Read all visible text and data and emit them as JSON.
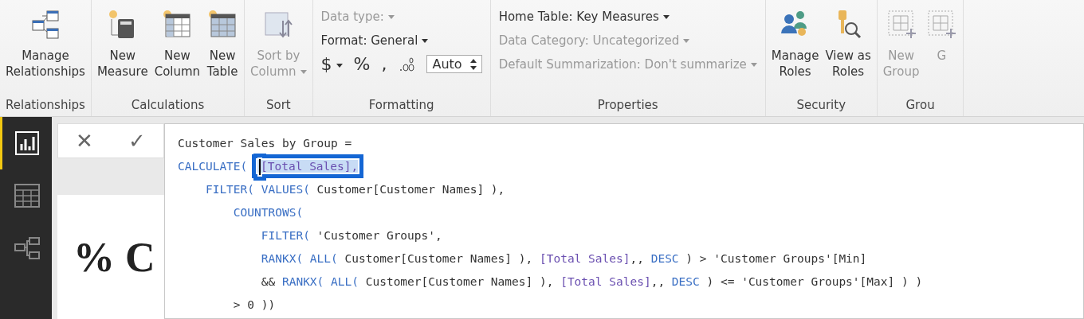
{
  "ribbon": {
    "groups": [
      {
        "label": "Relationships",
        "kind": "buttons",
        "buttons": [
          {
            "kind": "relationships",
            "label_lines": [
              "Manage",
              "Relationships"
            ],
            "disabled": false,
            "dropdown": false
          }
        ]
      },
      {
        "label": "Calculations",
        "kind": "buttons",
        "buttons": [
          {
            "kind": "measure",
            "label_lines": [
              "New",
              "Measure"
            ],
            "disabled": false,
            "dropdown": false
          },
          {
            "kind": "column",
            "label_lines": [
              "New",
              "Column"
            ],
            "disabled": false,
            "dropdown": false
          },
          {
            "kind": "table",
            "label_lines": [
              "New",
              "Table"
            ],
            "disabled": false,
            "dropdown": false
          }
        ]
      },
      {
        "label": "Sort",
        "kind": "buttons",
        "buttons": [
          {
            "kind": "sort",
            "label_lines": [
              "Sort by",
              "Column"
            ],
            "disabled": true,
            "dropdown": true
          }
        ]
      },
      {
        "label": "Formatting",
        "kind": "formatting",
        "rows": [
          {
            "label": "Data type:",
            "disabled": true
          },
          {
            "label": "Format: General",
            "disabled": false
          }
        ],
        "currency": "$",
        "percent": "%",
        "comma": ",",
        "decimals": "Auto"
      },
      {
        "label": "Properties",
        "kind": "properties",
        "rows": [
          {
            "label": "Home Table: Key Measures",
            "disabled": false
          },
          {
            "label": "Data Category: Uncategorized",
            "disabled": true
          },
          {
            "label": "Default Summarization: Don't summarize",
            "disabled": true
          }
        ]
      },
      {
        "label": "Security",
        "kind": "buttons",
        "buttons": [
          {
            "kind": "roles",
            "label_lines": [
              "Manage",
              "Roles"
            ],
            "disabled": false,
            "dropdown": false
          },
          {
            "kind": "view-roles",
            "label_lines": [
              "View as",
              "Roles"
            ],
            "disabled": false,
            "dropdown": false
          }
        ]
      },
      {
        "label": "Grou",
        "kind": "buttons",
        "buttons": [
          {
            "kind": "group",
            "label_lines": [
              "New",
              "Group"
            ],
            "disabled": true,
            "dropdown": false
          },
          {
            "kind": "group",
            "label_lines": [
              "G"
            ],
            "disabled": true,
            "dropdown": false
          }
        ]
      }
    ]
  },
  "sidebar": {
    "views": [
      {
        "kind": "report",
        "selected": true
      },
      {
        "kind": "data",
        "selected": false
      },
      {
        "kind": "model",
        "selected": false
      }
    ]
  },
  "formula_bar": {
    "cancel": "✕",
    "commit": "✓",
    "lines": [
      [
        {
          "text": "Customer Sales by Group =",
          "kind": "text",
          "selected": false
        }
      ],
      [
        {
          "text": "CALCULATE( ",
          "kind": "keyword",
          "selected": false
        },
        {
          "text": "[Total Sales],",
          "kind": "measure",
          "selected": true
        }
      ],
      [
        {
          "text": "    FILTER( VALUES(",
          "kind": "keyword",
          "selected": false
        },
        {
          "text": " Customer[Customer Names] ),",
          "kind": "text",
          "selected": false
        }
      ],
      [
        {
          "text": "        COUNTROWS(",
          "kind": "keyword",
          "selected": false
        }
      ],
      [
        {
          "text": "            FILTER(",
          "kind": "keyword",
          "selected": false
        },
        {
          "text": " 'Customer Groups',",
          "kind": "text",
          "selected": false
        }
      ],
      [
        {
          "text": "            RANKX( ALL(",
          "kind": "keyword",
          "selected": false
        },
        {
          "text": " Customer[Customer Names] ), ",
          "kind": "text",
          "selected": false
        },
        {
          "text": "[Total Sales]",
          "kind": "measure",
          "selected": false
        },
        {
          "text": ",, ",
          "kind": "text",
          "selected": false
        },
        {
          "text": "DESC",
          "kind": "keyword",
          "selected": false
        },
        {
          "text": " ) > 'Customer Groups'[Min]",
          "kind": "text",
          "selected": false
        }
      ],
      [
        {
          "text": "            && ",
          "kind": "text",
          "selected": false
        },
        {
          "text": "RANKX( ALL(",
          "kind": "keyword",
          "selected": false
        },
        {
          "text": " Customer[Customer Names] ), ",
          "kind": "text",
          "selected": false
        },
        {
          "text": "[Total Sales]",
          "kind": "measure",
          "selected": false
        },
        {
          "text": ",, ",
          "kind": "text",
          "selected": false
        },
        {
          "text": "DESC",
          "kind": "keyword",
          "selected": false
        },
        {
          "text": " ) <= 'Customer Groups'[Max] ) )",
          "kind": "text",
          "selected": false
        }
      ],
      [
        {
          "text": "        > 0 ))",
          "kind": "text",
          "selected": false
        }
      ]
    ]
  },
  "canvas": {
    "title": "% C"
  }
}
